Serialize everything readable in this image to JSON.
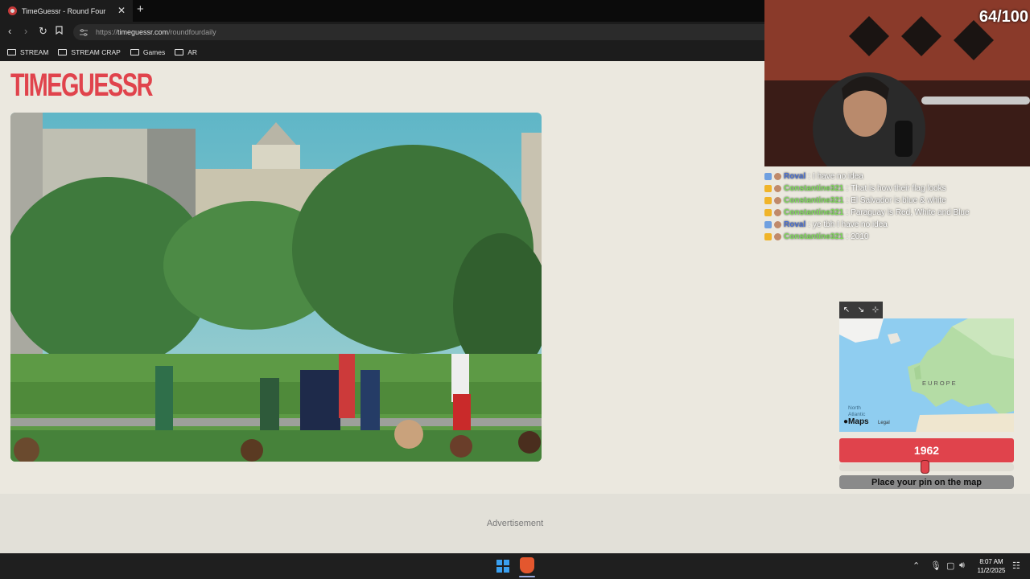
{
  "browser": {
    "tab_title": "TimeGuessr - Round Four",
    "tab_close": "✕",
    "new_tab": "+",
    "url_prefix": "https://",
    "url_host": "timeguessr.com",
    "url_path": "/roundfourdaily",
    "bookmarks": [
      "STREAM",
      "STREAM CRAP",
      "Games",
      "AR"
    ]
  },
  "site": {
    "logo": "TIMEGUESSR",
    "advertisement": "Advertisement"
  },
  "stream": {
    "score": "64/100"
  },
  "chat": [
    {
      "user": "Roval",
      "text": "I have no idea",
      "color": "#4a6fd1",
      "badge": "#6fa0e0"
    },
    {
      "user": "Constantine321",
      "text": "That is how their flag looks",
      "color": "#7fdc5a",
      "badge": "#f0b429"
    },
    {
      "user": "Constantine321",
      "text": "El Salvador is blue & white",
      "color": "#7fdc5a",
      "badge": "#f0b429"
    },
    {
      "user": "Constantine321",
      "text": "Paraguay is Red, White and Blue",
      "color": "#7fdc5a",
      "badge": "#f0b429"
    },
    {
      "user": "Roval",
      "text": "ye tbh I have no idea",
      "color": "#4a6fd1",
      "badge": "#6fa0e0"
    },
    {
      "user": "Constantine321",
      "text": "2010",
      "color": "#7fdc5a",
      "badge": "#f0b429"
    }
  ],
  "map": {
    "controls": [
      "↖",
      "↘",
      "⊹"
    ],
    "label_continent": "EUROPE",
    "label_ocean_1": "North",
    "label_ocean_2": "Atlantic",
    "attribution": "Maps",
    "legal": "Legal"
  },
  "guess": {
    "year": "1962",
    "slider_fraction": 0.49,
    "pin_prompt": "Place your pin on the map"
  },
  "taskbar": {
    "time": "8:07 AM",
    "date": "11/2/2025",
    "tray_icons": [
      "chevron-up-icon",
      "microphone-icon",
      "network-icon",
      "speaker-icon"
    ]
  }
}
